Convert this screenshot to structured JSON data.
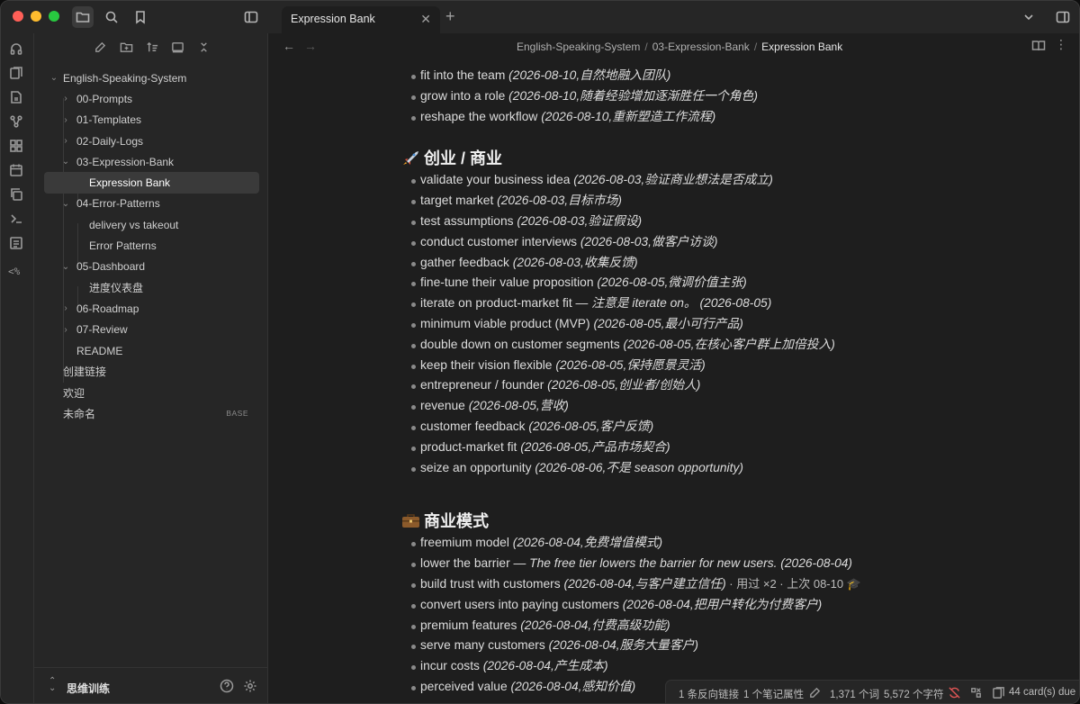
{
  "tab": {
    "title": "Expression Bank"
  },
  "breadcrumb": {
    "parts": [
      "English-Speaking-System",
      "03-Expression-Bank",
      "Expression Bank"
    ]
  },
  "sidebar": {
    "root": "English-Speaking-System",
    "items": [
      {
        "label": "00-Prompts"
      },
      {
        "label": "01-Templates"
      },
      {
        "label": "02-Daily-Logs"
      },
      {
        "label": "03-Expression-Bank"
      },
      {
        "label": "Expression Bank"
      },
      {
        "label": "04-Error-Patterns"
      },
      {
        "label": "delivery vs takeout"
      },
      {
        "label": "Error Patterns"
      },
      {
        "label": "05-Dashboard"
      },
      {
        "label": "进度仪表盘"
      },
      {
        "label": "06-Roadmap"
      },
      {
        "label": "07-Review"
      },
      {
        "label": "README"
      },
      {
        "label": "创建链接"
      },
      {
        "label": "欢迎"
      },
      {
        "label": "未命名",
        "badge": "BASE"
      }
    ],
    "vault_name": "思维训练"
  },
  "ribbon": {
    "bottom_text": "<%"
  },
  "content": {
    "top_items": [
      {
        "text": "fit into the team ",
        "note": "(2026-08-10,自然地融入团队)"
      },
      {
        "text": "grow into a role ",
        "note": "(2026-08-10,随着经验增加逐渐胜任一个角色)"
      },
      {
        "text": "reshape the workflow ",
        "note": "(2026-08-10,重新塑造工作流程)"
      }
    ],
    "section1": {
      "heading": "创业 / 商业",
      "items": [
        {
          "text": "validate your business idea ",
          "note": "(2026-08-03,验证商业想法是否成立)"
        },
        {
          "text": "target market ",
          "note": "(2026-08-03,目标市场)"
        },
        {
          "text": "test assumptions ",
          "note": "(2026-08-03,验证假设)"
        },
        {
          "text": "conduct customer interviews ",
          "note": "(2026-08-03,做客户访谈)"
        },
        {
          "text": "gather feedback ",
          "note": "(2026-08-03,收集反馈)"
        },
        {
          "text": "fine-tune their value proposition ",
          "note": "(2026-08-05,微调价值主张)"
        },
        {
          "text": "iterate on product-market fit — ",
          "note": "注意是 iterate on。 (2026-08-05)"
        },
        {
          "text": "minimum viable product (MVP) ",
          "note": "(2026-08-05,最小可行产品)"
        },
        {
          "text": "double down on customer segments ",
          "note": "(2026-08-05,在核心客户群上加倍投入)"
        },
        {
          "text": "keep their vision flexible ",
          "note": "(2026-08-05,保持愿景灵活)"
        },
        {
          "text": "entrepreneur / founder ",
          "note": "(2026-08-05,创业者/创始人)"
        },
        {
          "text": "revenue ",
          "note": "(2026-08-05,营收)"
        },
        {
          "text": "customer feedback ",
          "note": "(2026-08-05,客户反馈)"
        },
        {
          "text": "product-market fit ",
          "note": "(2026-08-05,产品市场契合)"
        },
        {
          "text": "seize an opportunity ",
          "note": "(2026-08-06,不是 season opportunity)"
        }
      ]
    },
    "section2": {
      "heading": "商业模式",
      "items": [
        {
          "text": "freemium model ",
          "note": "(2026-08-04,免费增值模式)"
        },
        {
          "text": "lower the barrier — ",
          "note": "The free tier lowers the barrier for new users. (2026-08-04)"
        },
        {
          "text": "build trust with customers ",
          "note": "(2026-08-04,与客户建立信任)",
          "extra": " · 用过 ×2 · 上次 08-10 🎓"
        },
        {
          "text": "convert users into paying customers ",
          "note": "(2026-08-04,把用户转化为付费客户)"
        },
        {
          "text": "premium features ",
          "note": "(2026-08-04,付费高级功能)"
        },
        {
          "text": "serve many customers ",
          "note": "(2026-08-04,服务大量客户)"
        },
        {
          "text": "incur costs ",
          "note": "(2026-08-04,产生成本)"
        },
        {
          "text": "perceived value ",
          "note": "(2026-08-04,感知价值)"
        }
      ]
    }
  },
  "statusbar": {
    "backlinks": "1 条反向链接",
    "properties": "1 个笔记属性",
    "words": "1,371 个词",
    "chars": "5,572 个字符",
    "cards_due": "44 card(s) due"
  },
  "colors": {
    "accent": "#3a3a3a",
    "background": "#1e1e1e",
    "panel": "#262626"
  }
}
